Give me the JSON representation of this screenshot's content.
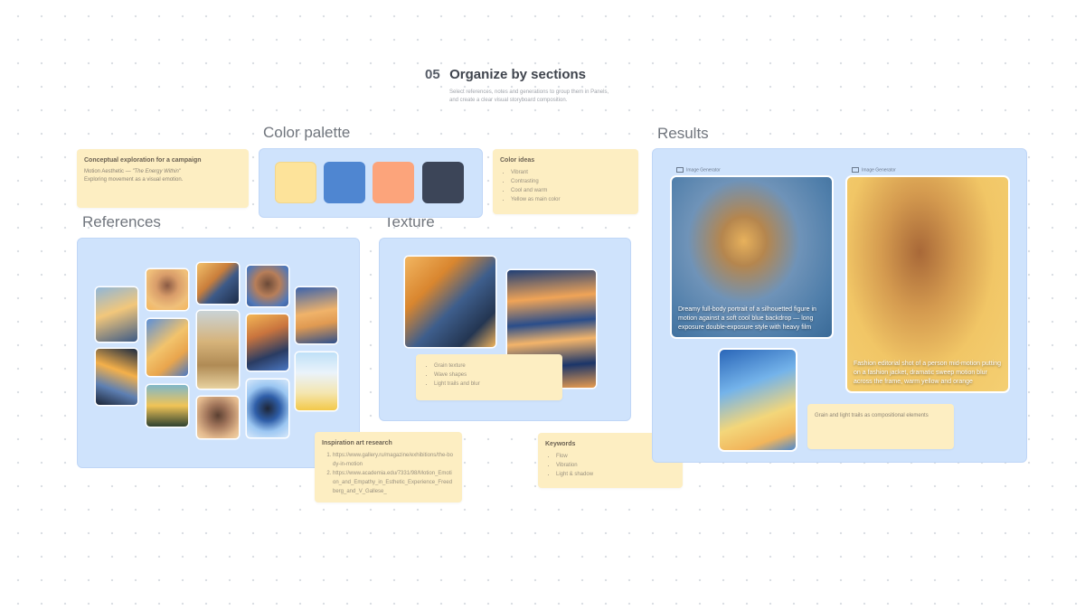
{
  "header": {
    "number": "05",
    "title": "Organize by sections",
    "subtitle": "Select references, notes and generations to group them in Panels, and create a clear visual storyboard composition."
  },
  "sections": {
    "color_palette": "Color palette",
    "references": "References",
    "texture": "Texture",
    "results": "Results"
  },
  "palette": {
    "colors": [
      "#fde39a",
      "#4f86d1",
      "#fca47b",
      "#3c4558"
    ]
  },
  "notes": {
    "campaign": {
      "title": "Conceptual exploration for a campaign",
      "line1": "Motion Aesthetic — ",
      "line1_em": "\"The Energy Within\"",
      "line2": "Exploring movement as a visual emotion."
    },
    "color_ideas": {
      "title": "Color ideas",
      "items": [
        "Vibrant",
        "Contrasting",
        "Cool and warm",
        "Yellow as main color"
      ]
    },
    "texture": {
      "items": [
        "Grain texture",
        "Wave shapes",
        "Light trails and blur"
      ]
    },
    "inspiration": {
      "title": "Inspiration art research",
      "items": [
        "https://www.gallery.ru/magazine/exhibitions/the-body-in-motion",
        "https://www.academia.edu/7331/98/Motion_Emotion_and_Empathy_in_Esthetic_Experience_Freedberg_and_V_Gallese_"
      ]
    },
    "keywords": {
      "title": "Keywords",
      "items": [
        "Flow",
        "Vibration",
        "Light & shadow"
      ]
    },
    "results_note": "Grain and light trails as compositional elements"
  },
  "results": {
    "generator_label": "Image Generator",
    "caption1": "Dreamy full-body portrait of a silhouetted figure in motion against a soft cool blue backdrop — long exposure double-exposure style with heavy film",
    "caption2": "Fashion editorial shot of a person mid-motion putting on a fashion jacket, dramatic sweep motion blur across the frame, warm yellow and orange"
  }
}
